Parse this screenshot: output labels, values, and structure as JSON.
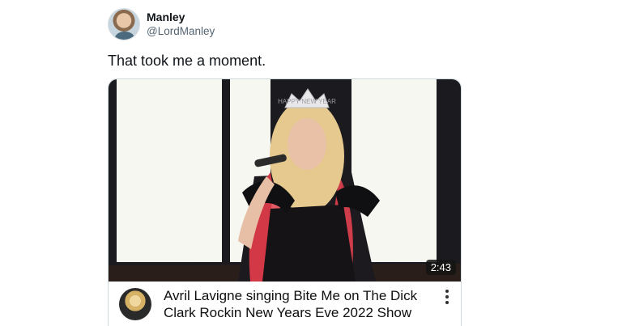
{
  "tweet": {
    "display_name": "Manley",
    "handle": "@LordManley",
    "text": "That took me a moment."
  },
  "video_card": {
    "duration": "2:43",
    "title_line1": "Avril Lavigne singing Bite Me on The Dick",
    "title_line2": "Clark Rockin New Years Eve 2022 Show",
    "tiara_text": "HAPPY NEW YEAR",
    "icons": {
      "more": "vertical-ellipsis-icon"
    }
  }
}
